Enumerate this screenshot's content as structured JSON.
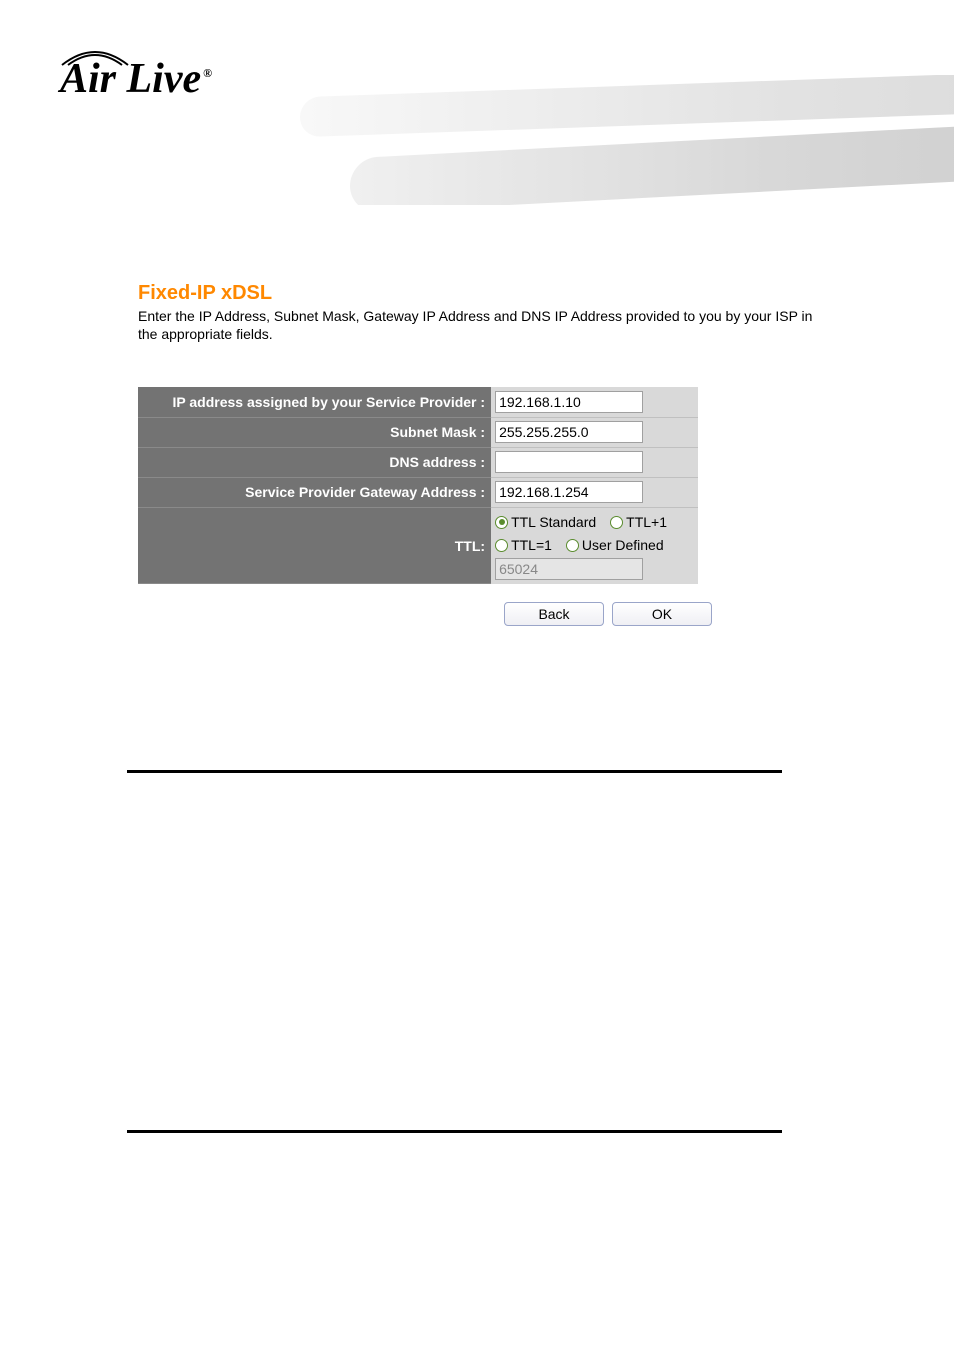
{
  "brand": "Air Live",
  "page": {
    "title": "Fixed-IP xDSL",
    "description": "Enter the IP Address, Subnet Mask, Gateway IP Address and DNS IP Address provided to you by your ISP in the appropriate fields."
  },
  "form": {
    "ip_label": "IP address assigned by your Service Provider :",
    "ip_value": "192.168.1.10",
    "subnet_label": "Subnet Mask :",
    "subnet_value": "255.255.255.0",
    "dns_label": "DNS address :",
    "dns_value": "",
    "gateway_label": "Service Provider Gateway Address :",
    "gateway_value": "192.168.1.254",
    "ttl_label": "TTL:",
    "ttl_options": {
      "standard": "TTL Standard",
      "plus1": "TTL+1",
      "eq1": "TTL=1",
      "user": "User Defined"
    },
    "ttl_selected": "standard",
    "ttl_user_value": "65024"
  },
  "buttons": {
    "back": "Back",
    "ok": "OK"
  }
}
